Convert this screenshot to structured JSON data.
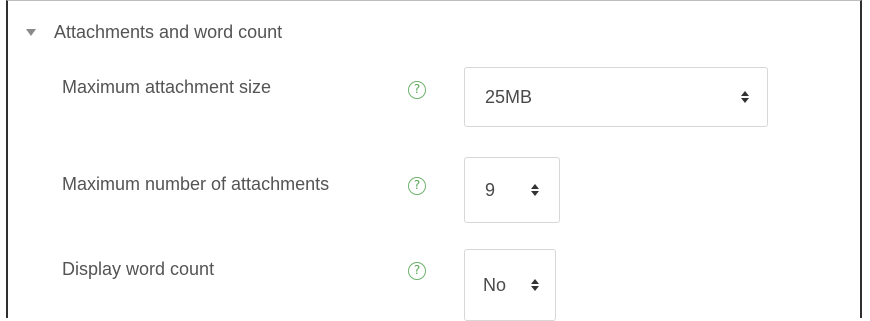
{
  "section": {
    "title": "Attachments and word count"
  },
  "fields": {
    "max_attachment_size": {
      "label": "Maximum attachment size",
      "help": "?",
      "value": "25MB"
    },
    "max_attachments": {
      "label": "Maximum number of attachments",
      "help": "?",
      "value": "9"
    },
    "display_word_count": {
      "label": "Display word count",
      "help": "?",
      "value": "No"
    }
  },
  "colors": {
    "help_icon": "#6fb36f",
    "text": "#545454",
    "border": "#d7d7d7"
  }
}
